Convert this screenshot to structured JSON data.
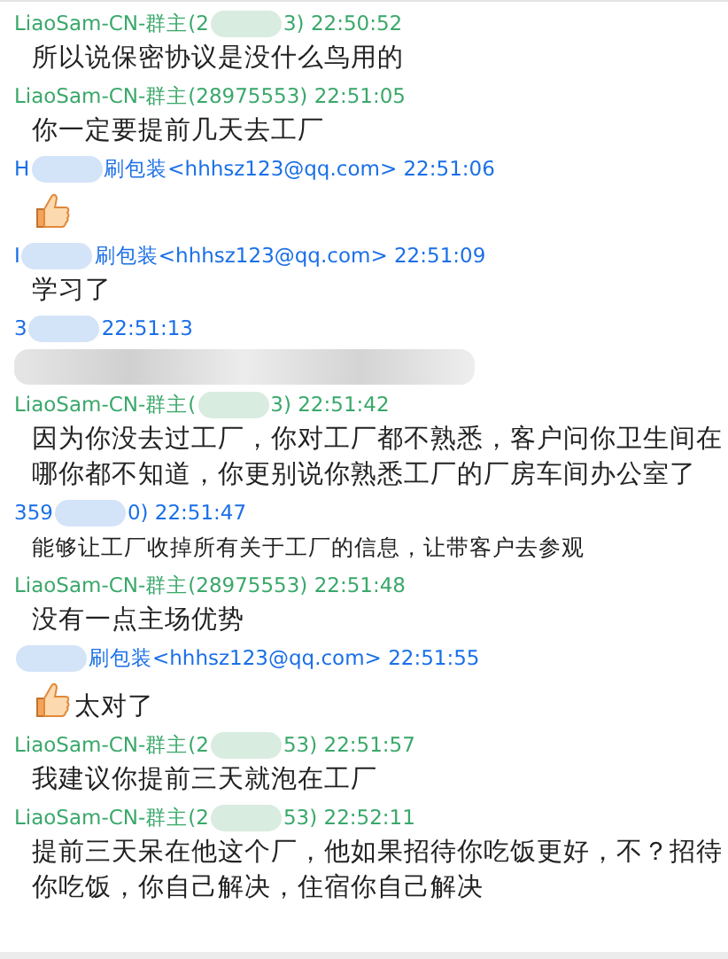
{
  "messages": [
    {
      "kind": "owner",
      "sender_before": "LiaoSam-CN-群主(2",
      "blurred": true,
      "sender_after": "3) 22:50:52",
      "body": "所以说保密协议是没什么鸟用的"
    },
    {
      "kind": "owner",
      "sender_before": "LiaoSam-CN-群主(28975553) 22:51:05",
      "body": "你一定要提前几天去工厂"
    },
    {
      "kind": "member",
      "sender_before": "H",
      "blurred": true,
      "sender_after": "刷包装<hhhsz123@qq.com> 22:51:06",
      "emoji": true
    },
    {
      "kind": "member",
      "sender_before": "I",
      "blurred": true,
      "sender_after": "刷包装<hhhsz123@qq.com> 22:51:09",
      "body": "学习了"
    },
    {
      "kind": "member",
      "sender_before": "3",
      "blurred": true,
      "sender_after": "22:51:13",
      "body_blurred": true
    },
    {
      "kind": "owner",
      "sender_before": "LiaoSam-CN-群主(",
      "blurred": true,
      "sender_after": "3) 22:51:42",
      "body": "因为你没去过工厂，你对工厂都不熟悉，客户问你卫生间在哪你都不知道，你更别说你熟悉工厂的厂房车间办公室了"
    },
    {
      "kind": "member",
      "sender_before": "359",
      "blurred": true,
      "sender_after": "0) 22:51:47",
      "body": "能够让工厂收掉所有关于工厂的信息，让带客户去参观",
      "small_text": true
    },
    {
      "kind": "owner",
      "sender_before": "LiaoSam-CN-群主(28975553) 22:51:48",
      "body": "没有一点主场优势"
    },
    {
      "kind": "member",
      "blurred": true,
      "sender_after": "刷包装<hhhsz123@qq.com> 22:51:55",
      "body": "太对了",
      "emoji": true
    },
    {
      "kind": "owner",
      "sender_before": "LiaoSam-CN-群主(2",
      "blurred": true,
      "sender_after": "53) 22:51:57",
      "body": "我建议你提前三天就泡在工厂"
    },
    {
      "kind": "owner",
      "sender_before": "LiaoSam-CN-群主(2",
      "blurred": true,
      "sender_after": "53) 22:52:11",
      "body": "提前三天呆在他这个厂，他如果招待你吃饭更好，不？招待你吃饭，你自己解决，住宿你自己解决"
    }
  ]
}
